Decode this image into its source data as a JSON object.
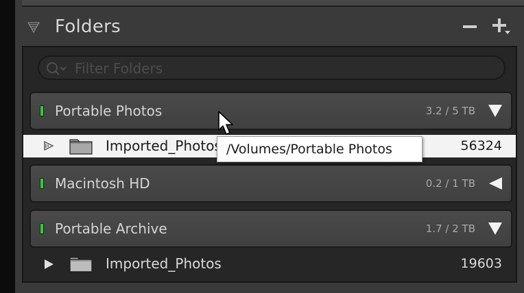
{
  "panel": {
    "title": "Folders",
    "remove_label": "−",
    "add_label": "+"
  },
  "filter": {
    "placeholder": "Filter Folders"
  },
  "volumes": [
    {
      "name": "Portable Photos",
      "usage": "3.2 / 5 TB",
      "expanded": true,
      "status_color": "#3bc63b",
      "folder": {
        "name": "Imported_Photos",
        "count": "56324",
        "selected": true
      }
    },
    {
      "name": "Macintosh HD",
      "usage": "0.2 / 1 TB",
      "expanded": false,
      "status_color": "#3bc63b"
    },
    {
      "name": "Portable Archive",
      "usage": "1.7 / 2 TB",
      "expanded": true,
      "status_color": "#3bc63b",
      "folder": {
        "name": "Imported_Photos",
        "count": "19603",
        "selected": false
      }
    }
  ],
  "tooltip": {
    "text": "/Volumes/Portable Photos"
  },
  "icons": {
    "panel_toggle": "collapse-triangle-icon",
    "search": "search-icon",
    "folder": "folder-icon",
    "cursor": "mouse-pointer-icon"
  },
  "colors": {
    "panel_bg": "#3a3a3a",
    "content_bg": "#262626",
    "selection_bg": "#f3f3f3",
    "volume_indicator": "#3bc63b"
  }
}
